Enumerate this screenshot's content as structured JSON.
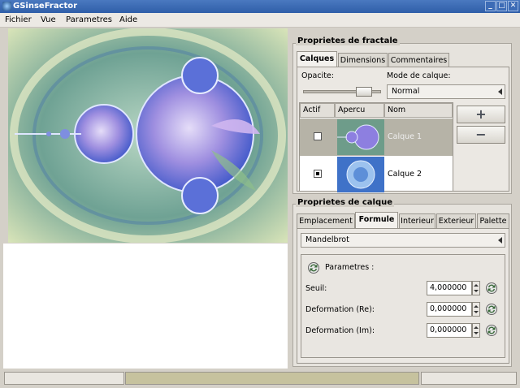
{
  "window": {
    "title": "GSinseFractor"
  },
  "menu": {
    "items": [
      "Fichier",
      "Vue",
      "Parametres",
      "Aide"
    ]
  },
  "fractal_props": {
    "title": "Proprietes de fractale",
    "tabs": [
      "Calques",
      "Dimensions",
      "Commentaires"
    ],
    "active_tab": 0,
    "opacity_label": "Opacite:",
    "opacity_value": 0.85,
    "blend_mode_label": "Mode de calque:",
    "blend_mode_value": "Normal",
    "layers_table": {
      "columns": [
        "Actif",
        "Apercu",
        "Nom"
      ],
      "rows": [
        {
          "active": false,
          "name": "Calque 1",
          "selected": true
        },
        {
          "active": true,
          "name": "Calque 2",
          "selected": false
        }
      ]
    },
    "add_layer_label": "+",
    "remove_layer_label": "−"
  },
  "layer_props": {
    "title": "Proprietes de calque",
    "tabs": [
      "Emplacement",
      "Formule",
      "Interieur",
      "Exterieur",
      "Palette"
    ],
    "active_tab": 1,
    "formula_value": "Mandelbrot",
    "params_title": "Parametres :",
    "params": [
      {
        "label": "Seuil:",
        "value": "4,000000"
      },
      {
        "label": "Deformation (Re):",
        "value": "0,000000"
      },
      {
        "label": "Deformation (Im):",
        "value": "0,000000"
      }
    ]
  },
  "icons": {
    "window_buttons": [
      "minimize-icon",
      "maximize-icon",
      "close-icon"
    ],
    "window_button_glyphs": [
      "_",
      "□",
      "✕"
    ],
    "reset": "reset-icon"
  },
  "colors": {
    "titlebar": "#2f5ea8",
    "selected_row": "#b6b3a7",
    "progress": "#c6c29e"
  }
}
